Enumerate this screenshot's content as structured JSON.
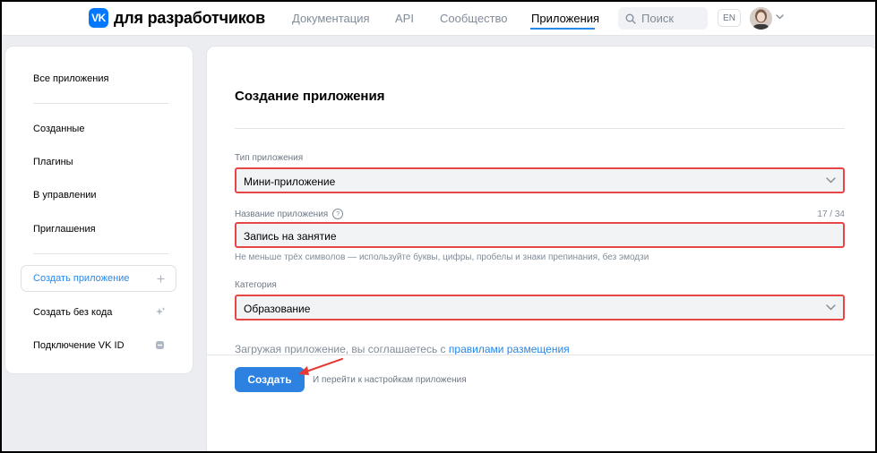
{
  "header": {
    "logo_badge": "VK",
    "logo_text": "для разработчиков",
    "nav": {
      "docs": "Документация",
      "api": "API",
      "community": "Сообщество",
      "apps": "Приложения"
    },
    "search_placeholder": "Поиск",
    "lang": "EN"
  },
  "sidebar": {
    "all_apps": "Все приложения",
    "created": "Созданные",
    "plugins": "Плагины",
    "managed": "В управлении",
    "invites": "Приглашения",
    "create_app": "Создать приложение",
    "create_nocode": "Создать без кода",
    "connect_vkid": "Подключение VK ID"
  },
  "main": {
    "title": "Создание приложения",
    "type": {
      "label": "Тип приложения",
      "value": "Мини-приложение"
    },
    "name": {
      "label": "Название приложения",
      "counter": "17 / 34",
      "value": "Запись на занятие",
      "hint": "Не меньше трёх символов — используйте буквы, цифры, пробелы и знаки препинания, без эмодзи"
    },
    "category": {
      "label": "Категория",
      "value": "Образование"
    },
    "agree_text": "Загружая приложение, вы соглашаетесь с ",
    "agree_link": "правилами размещения",
    "create_button": "Создать",
    "after_button": "И перейти к настройкам приложения"
  },
  "colors": {
    "accent": "#2688eb",
    "button": "#2d81e0",
    "highlight_border": "#e64646",
    "annotation_arrow": "#e53935"
  }
}
